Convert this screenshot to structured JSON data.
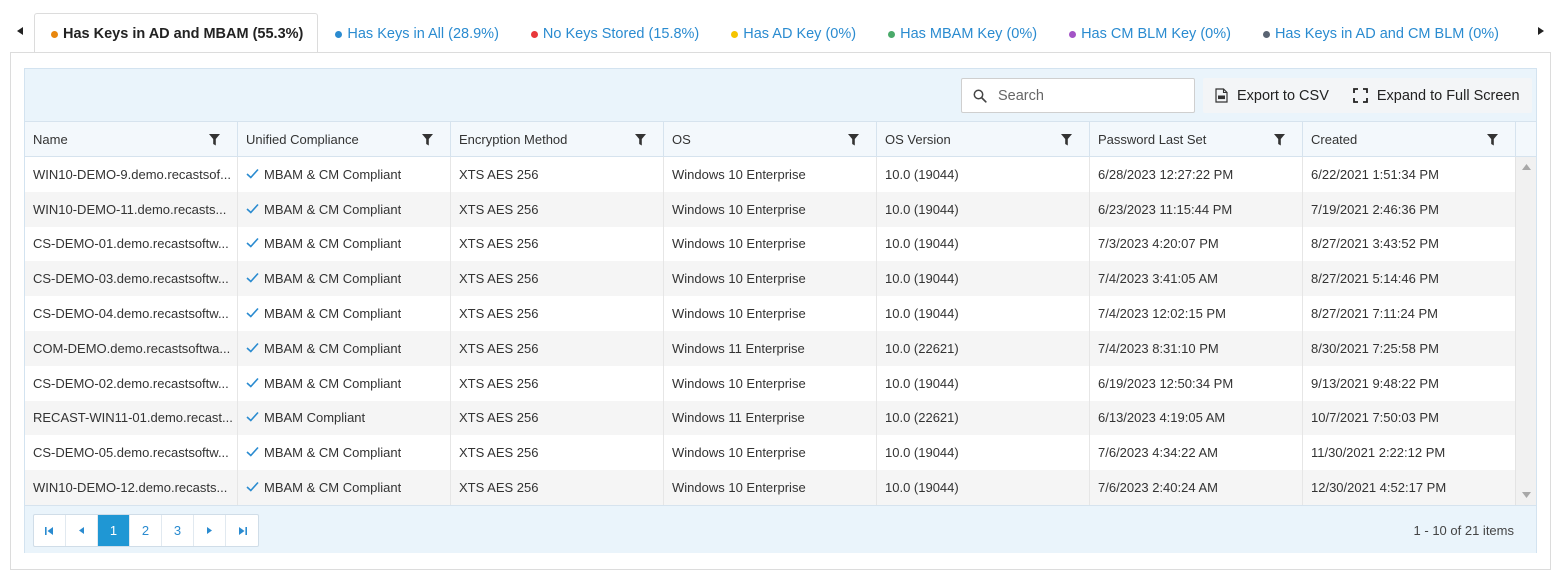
{
  "tabs": [
    {
      "label": "Has Keys in AD and MBAM (55.3%)",
      "color": "#e8870e",
      "active": true
    },
    {
      "label": "Has Keys in All (28.9%)",
      "color": "#2a8bd0",
      "active": false
    },
    {
      "label": "No Keys Stored (15.8%)",
      "color": "#e8383a",
      "active": false
    },
    {
      "label": "Has AD Key (0%)",
      "color": "#f5c400",
      "active": false
    },
    {
      "label": "Has MBAM Key (0%)",
      "color": "#4aaa6a",
      "active": false
    },
    {
      "label": "Has CM BLM Key (0%)",
      "color": "#a354c6",
      "active": false
    },
    {
      "label": "Has Keys in AD and CM BLM (0%)",
      "color": "#5a6472",
      "active": false
    }
  ],
  "toolbar": {
    "search_placeholder": "Search",
    "export_label": "Export to CSV",
    "expand_label": "Expand to Full Screen"
  },
  "columns": [
    "Name",
    "Unified Compliance",
    "Encryption Method",
    "OS",
    "OS Version",
    "Password Last Set",
    "Created"
  ],
  "rows": [
    [
      "WIN10-DEMO-9.demo.recastsof...",
      "MBAM & CM Compliant",
      "XTS AES 256",
      "Windows 10 Enterprise",
      "10.0 (19044)",
      "6/28/2023 12:27:22 PM",
      "6/22/2021 1:51:34 PM"
    ],
    [
      "WIN10-DEMO-11.demo.recasts...",
      "MBAM & CM Compliant",
      "XTS AES 256",
      "Windows 10 Enterprise",
      "10.0 (19044)",
      "6/23/2023 11:15:44 PM",
      "7/19/2021 2:46:36 PM"
    ],
    [
      "CS-DEMO-01.demo.recastsoftw...",
      "MBAM & CM Compliant",
      "XTS AES 256",
      "Windows 10 Enterprise",
      "10.0 (19044)",
      "7/3/2023 4:20:07 PM",
      "8/27/2021 3:43:52 PM"
    ],
    [
      "CS-DEMO-03.demo.recastsoftw...",
      "MBAM & CM Compliant",
      "XTS AES 256",
      "Windows 10 Enterprise",
      "10.0 (19044)",
      "7/4/2023 3:41:05 AM",
      "8/27/2021 5:14:46 PM"
    ],
    [
      "CS-DEMO-04.demo.recastsoftw...",
      "MBAM & CM Compliant",
      "XTS AES 256",
      "Windows 10 Enterprise",
      "10.0 (19044)",
      "7/4/2023 12:02:15 PM",
      "8/27/2021 7:11:24 PM"
    ],
    [
      "COM-DEMO.demo.recastsoftwa...",
      "MBAM & CM Compliant",
      "XTS AES 256",
      "Windows 11 Enterprise",
      "10.0 (22621)",
      "7/4/2023 8:31:10 PM",
      "8/30/2021 7:25:58 PM"
    ],
    [
      "CS-DEMO-02.demo.recastsoftw...",
      "MBAM & CM Compliant",
      "XTS AES 256",
      "Windows 10 Enterprise",
      "10.0 (19044)",
      "6/19/2023 12:50:34 PM",
      "9/13/2021 9:48:22 PM"
    ],
    [
      "RECAST-WIN11-01.demo.recast...",
      "MBAM Compliant",
      "XTS AES 256",
      "Windows 11 Enterprise",
      "10.0 (22621)",
      "6/13/2023 4:19:05 AM",
      "10/7/2021 7:50:03 PM"
    ],
    [
      "CS-DEMO-05.demo.recastsoftw...",
      "MBAM & CM Compliant",
      "XTS AES 256",
      "Windows 10 Enterprise",
      "10.0 (19044)",
      "7/6/2023 4:34:22 AM",
      "11/30/2021 2:22:12 PM"
    ],
    [
      "WIN10-DEMO-12.demo.recasts...",
      "MBAM & CM Compliant",
      "XTS AES 256",
      "Windows 10 Enterprise",
      "10.0 (19044)",
      "7/6/2023 2:40:24 AM",
      "12/30/2021 4:52:17 PM"
    ]
  ],
  "pager": {
    "pages": [
      "1",
      "2",
      "3"
    ],
    "current_page": "1",
    "info": "1 - 10 of 21 items"
  },
  "icons": {
    "compliance": "check-icon",
    "filter": "filter-icon",
    "search": "search-icon",
    "export": "csv-file-icon",
    "expand": "expand-icon"
  },
  "colors": {
    "accent": "#1f97d4",
    "link": "#2a8bd0",
    "check": "#2a8bd0"
  }
}
